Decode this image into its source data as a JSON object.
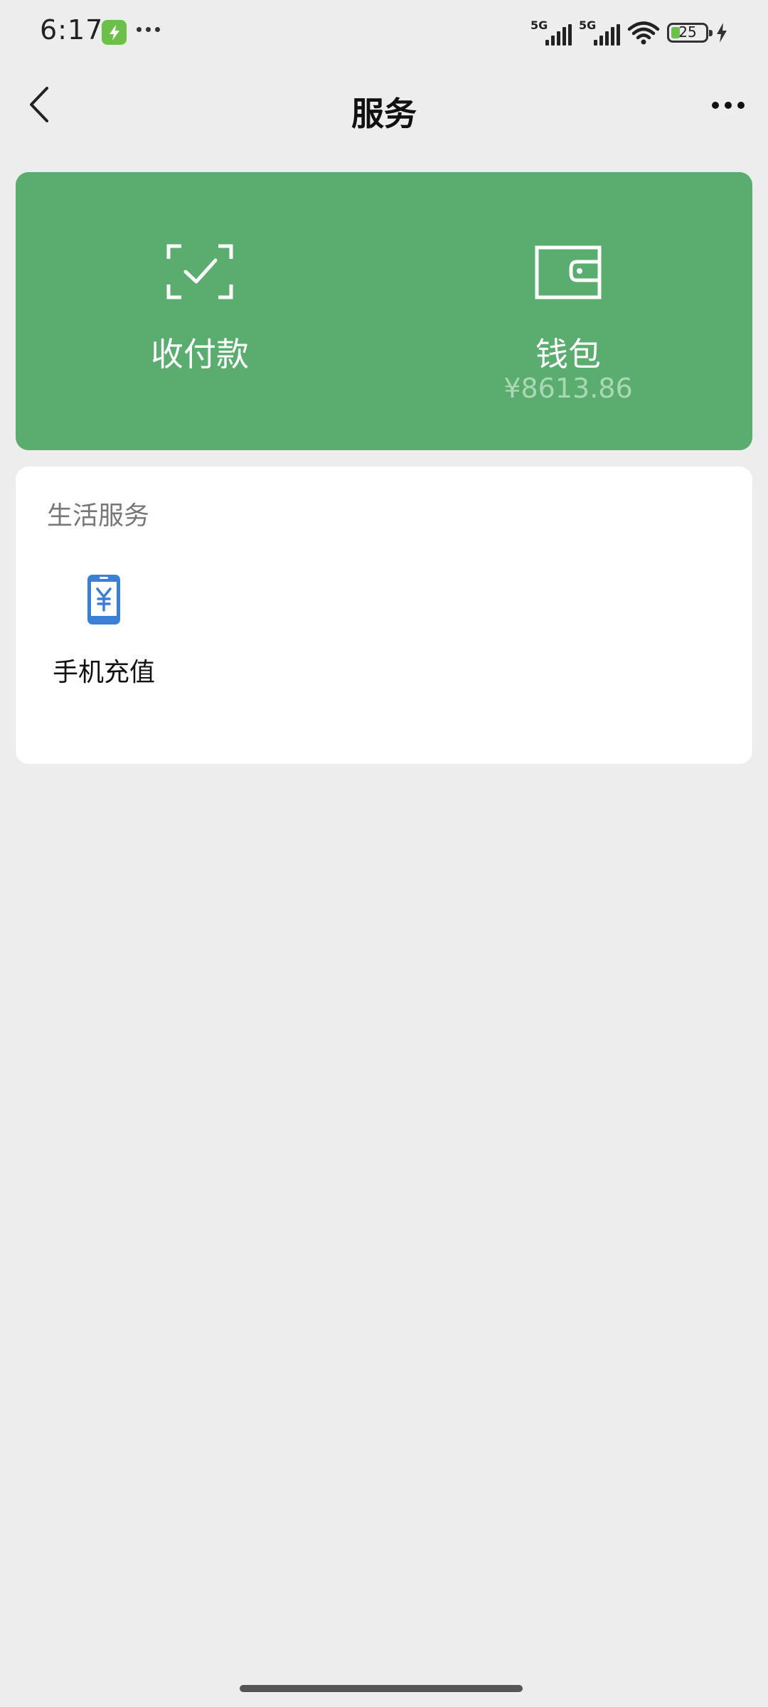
{
  "status_bar": {
    "time": "6:17",
    "signal_1_label": "5G",
    "signal_2_label": "5G",
    "battery_level": "25"
  },
  "nav": {
    "title": "服务"
  },
  "pay_card": {
    "background_color": "#5aad6e",
    "collect_pay": {
      "label": "收付款",
      "icon": "scan-check-icon"
    },
    "wallet": {
      "label": "钱包",
      "balance": "¥8613.86",
      "icon": "wallet-icon"
    }
  },
  "life_services": {
    "title": "生活服务",
    "items": [
      {
        "label": "手机充值",
        "icon": "phone-recharge-icon",
        "icon_color": "#3b7fd6"
      }
    ]
  }
}
